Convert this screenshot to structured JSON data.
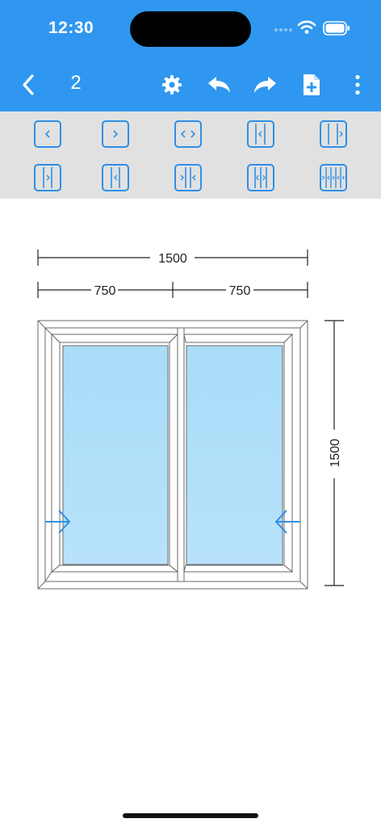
{
  "status_bar": {
    "time": "12:30"
  },
  "toolbar": {
    "page_number": "2",
    "icons": [
      "chevron-left-icon",
      "gear-icon",
      "undo-icon",
      "redo-icon",
      "add-document-icon",
      "more-vertical-icon"
    ]
  },
  "palette": {
    "row1": [
      "slide-left",
      "slide-right",
      "slide-both",
      "fixed-slide-fixed",
      "fixed-slide-right"
    ],
    "row2": [
      "two-sash-inward-right",
      "two-sash-inward-left",
      "two-sash-outward",
      "three-sash-meeting",
      "four-sash-meeting"
    ]
  },
  "drawing": {
    "overall_width": "1500",
    "sash_widths": [
      "750",
      "750"
    ],
    "overall_height": "1500"
  },
  "colors": {
    "header": "#2F97F0",
    "palette_bg": "#E1E1E1",
    "accent": "#2F8FE6",
    "glass": "#A9DCF8"
  }
}
